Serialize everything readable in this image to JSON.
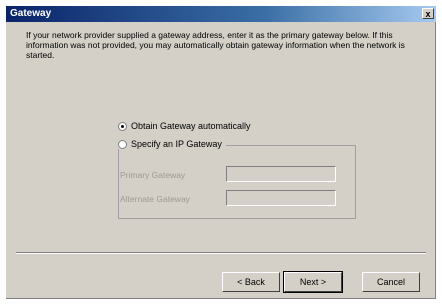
{
  "window": {
    "title": "Gateway",
    "close_glyph": "x"
  },
  "description": "If your network provider supplied a gateway address, enter it as the primary gateway below. If this information was not provided, you may automatically obtain gateway information when the network is started.",
  "options": {
    "obtain_auto": {
      "label": "Obtain Gateway automatically",
      "selected": true
    },
    "specify": {
      "label": "Specify an IP Gateway",
      "selected": false
    }
  },
  "fields": {
    "primary": {
      "label": "Primary Gateway",
      "value": "",
      "enabled": false
    },
    "alternate": {
      "label": "Alternate Gateway",
      "value": "",
      "enabled": false
    }
  },
  "buttons": {
    "back": "< Back",
    "next": "Next >",
    "cancel": "Cancel"
  }
}
